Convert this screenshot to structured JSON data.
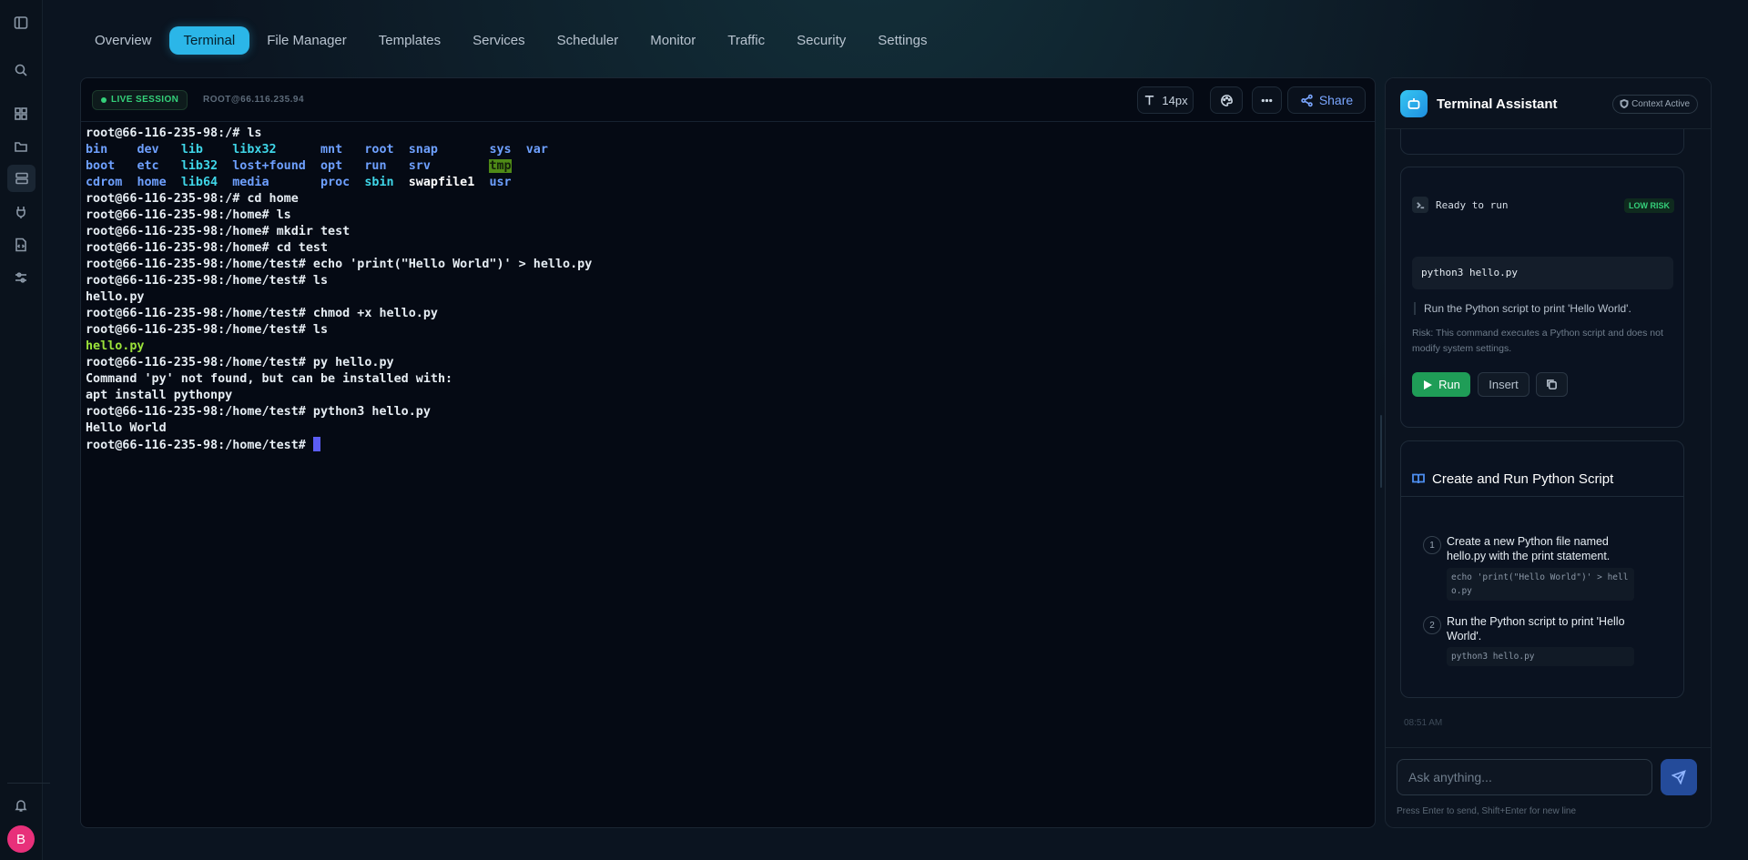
{
  "nav": {
    "tabs": [
      {
        "label": "Overview"
      },
      {
        "label": "Terminal"
      },
      {
        "label": "File Manager"
      },
      {
        "label": "Templates"
      },
      {
        "label": "Services"
      },
      {
        "label": "Scheduler"
      },
      {
        "label": "Monitor"
      },
      {
        "label": "Traffic"
      },
      {
        "label": "Security"
      },
      {
        "label": "Settings"
      }
    ],
    "active_tab": "Terminal"
  },
  "sidebar": {
    "icons": [
      "sidebar-toggle-icon",
      "search-icon",
      "dashboard-icon",
      "folder-icon",
      "server-icon",
      "plug-icon",
      "file-code-icon",
      "sliders-icon",
      "bell-icon"
    ],
    "avatar_letter": "B",
    "avatar_color": "#e8307a"
  },
  "terminal": {
    "status_label": "LIVE SESSION",
    "host": "ROOT@66.116.235.94",
    "font_size_label": "14px",
    "share_label": "Share"
  },
  "assistant": {
    "title": "Terminal Assistant",
    "context_badge": "Context Active",
    "command_card": {
      "status": "Ready to run",
      "risk_badge": "LOW RISK",
      "command": "python3 hello.py",
      "description": "Run the Python script to print 'Hello World'.",
      "risk_text": "Risk: This command executes a Python script and does not modify system settings.",
      "run_label": "Run",
      "insert_label": "Insert"
    },
    "plan": {
      "title": "Create and Run Python Script",
      "steps": [
        {
          "num": "1",
          "text": "Create a new Python file named hello.py with the print statement.",
          "code": "echo 'print(\"Hello World\")' > hello.py"
        },
        {
          "num": "2",
          "text": "Run the Python script to print 'Hello World'.",
          "code": "python3 hello.py"
        }
      ]
    },
    "timestamp": "08:51 AM",
    "input_placeholder": "Ask anything...",
    "hint": "Press Enter to send, Shift+Enter for new line"
  },
  "colors": {
    "accent": "#2bb6e8",
    "live": "#34d07a",
    "run_button": "#1f9d57",
    "dir_color": "#6ea0ff",
    "link_color": "#3fd6e8",
    "exec_color": "#9be23a"
  }
}
